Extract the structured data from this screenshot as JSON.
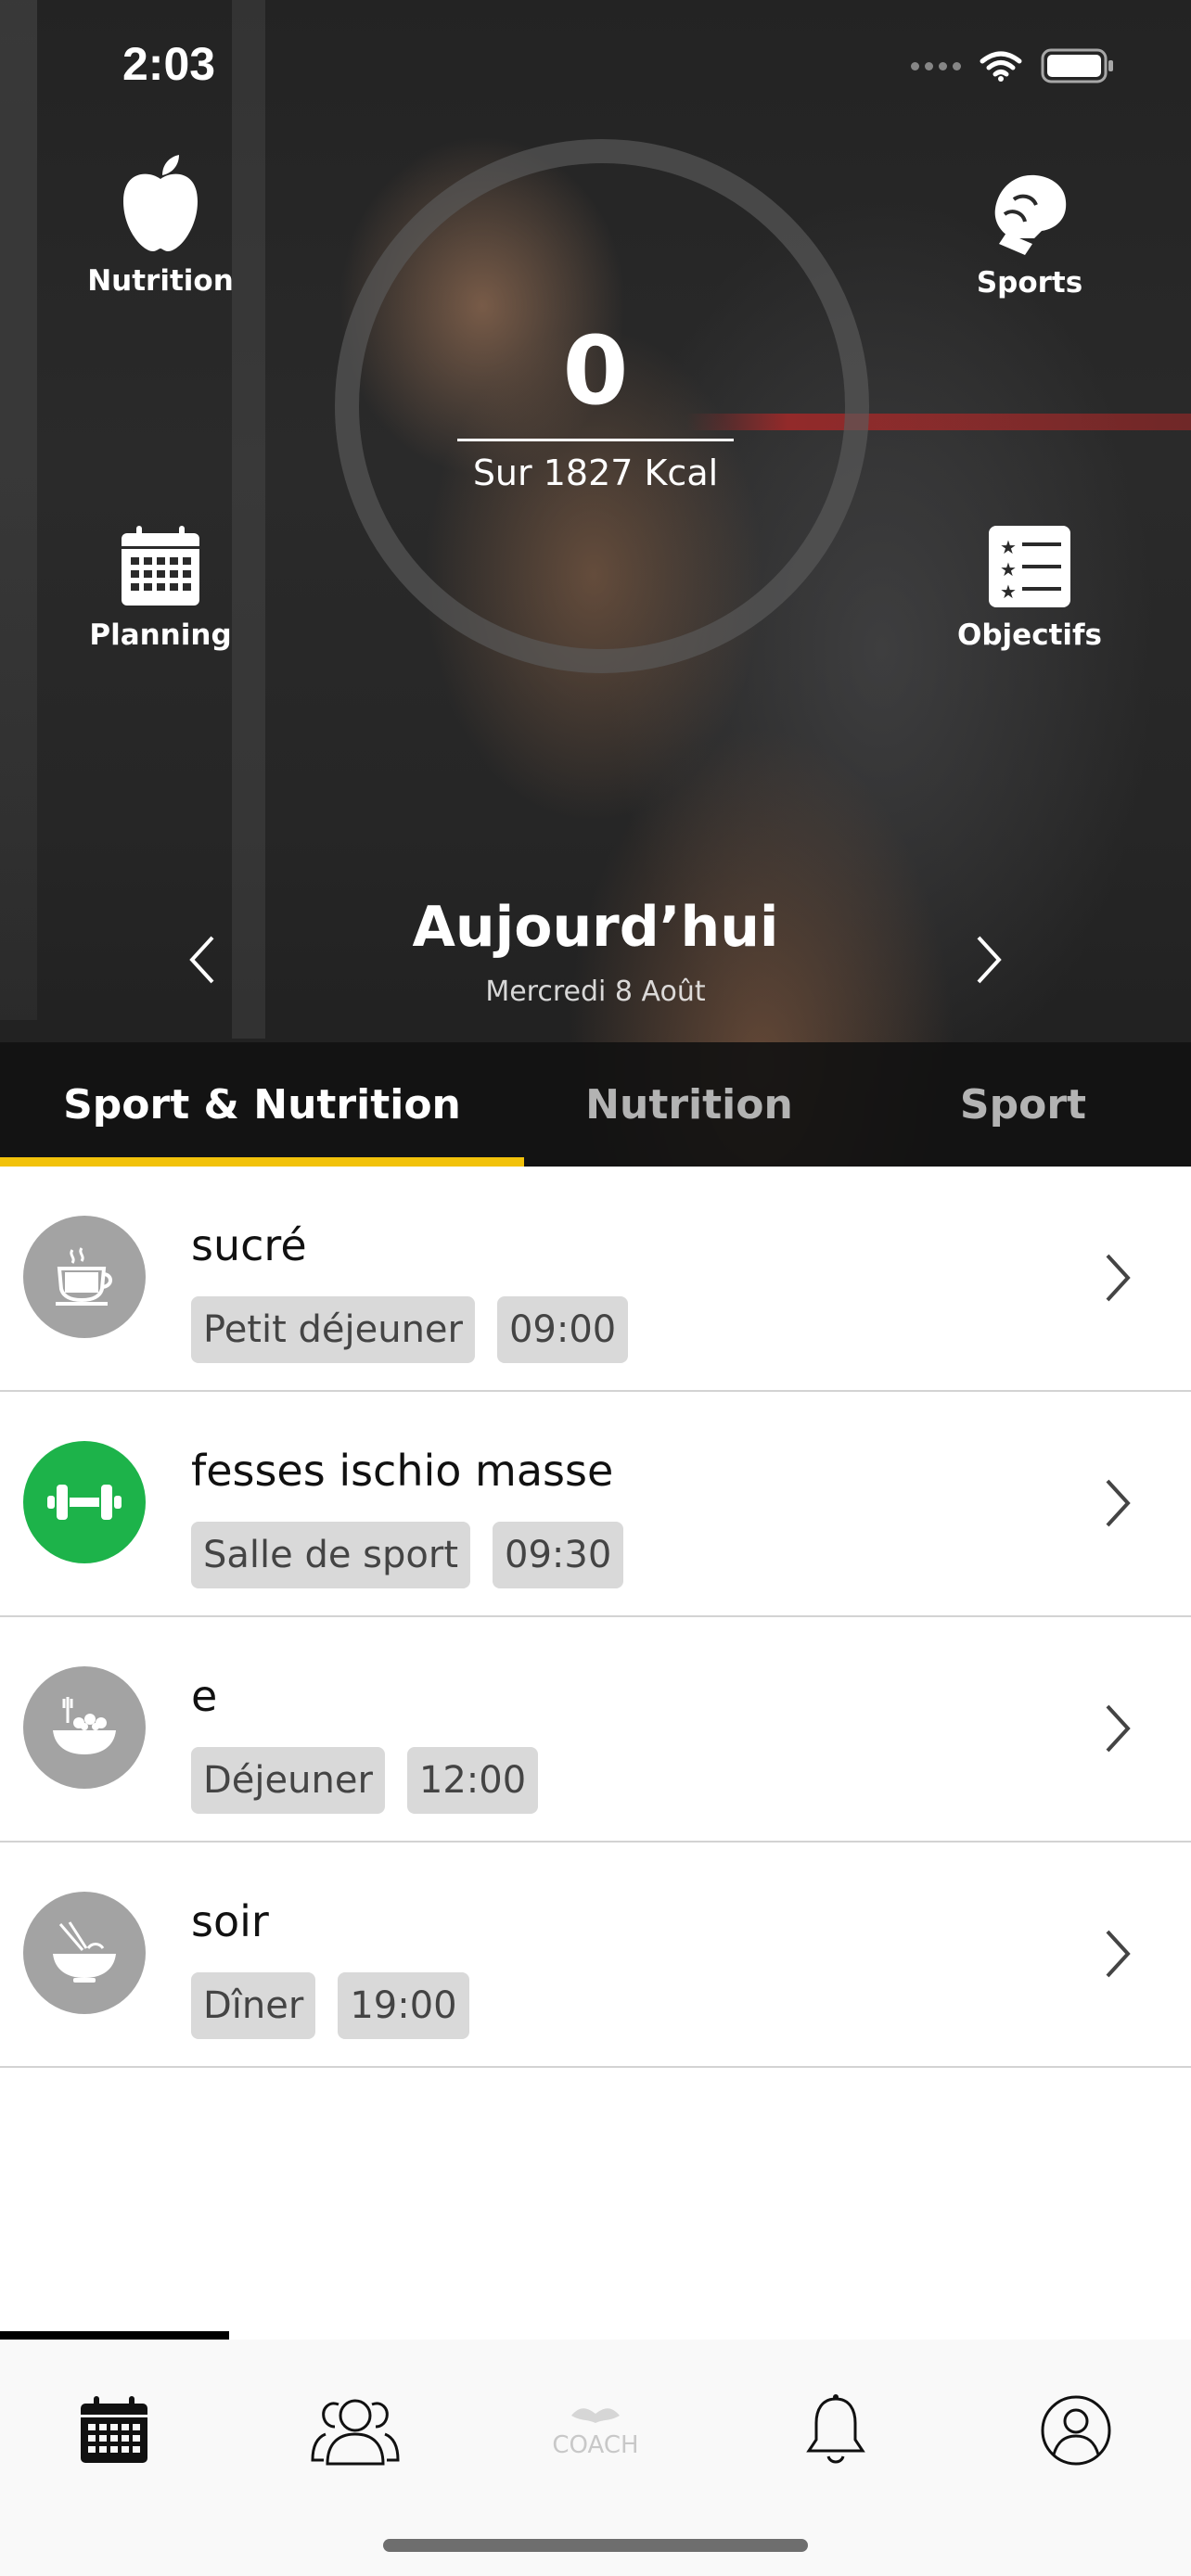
{
  "status_bar": {
    "time": "2:03"
  },
  "hero": {
    "calories_value": "0",
    "calories_label": "Sur 1827 Kcal",
    "shortcuts": [
      {
        "label": "Nutrition",
        "icon": "apple-icon"
      },
      {
        "label": "Sports",
        "icon": "boxing-glove-icon"
      },
      {
        "label": "Planning",
        "icon": "calendar-icon"
      },
      {
        "label": "Objectifs",
        "icon": "checklist-icon"
      }
    ],
    "date_title": "Aujourd’hui",
    "date_subtitle": "Mercredi 8 Août"
  },
  "tabs": [
    {
      "label": "Sport & Nutrition",
      "active": true
    },
    {
      "label": "Nutrition",
      "active": false
    },
    {
      "label": "Sport",
      "active": false
    }
  ],
  "accent_color": "#f2c20a",
  "items": [
    {
      "title": "sucré",
      "category": "Petit déjeuner",
      "time": "09:00",
      "icon": "coffee-cup-icon",
      "icon_bg": "#a3a3a3"
    },
    {
      "title": "fesses ischio masse",
      "category": "Salle de sport",
      "time": "09:30",
      "icon": "dumbbell-icon",
      "icon_bg": "#1db34a"
    },
    {
      "title": "e",
      "category": "Déjeuner",
      "time": "12:00",
      "icon": "salad-bowl-icon",
      "icon_bg": "#a3a3a3"
    },
    {
      "title": "soir",
      "category": "Dîner",
      "time": "19:00",
      "icon": "noodle-bowl-icon",
      "icon_bg": "#a3a3a3"
    }
  ],
  "bottom_nav": {
    "items": [
      "calendar-icon",
      "community-icon",
      "coach-logo",
      "bell-icon",
      "profile-icon"
    ],
    "coach_label": "COACH"
  }
}
